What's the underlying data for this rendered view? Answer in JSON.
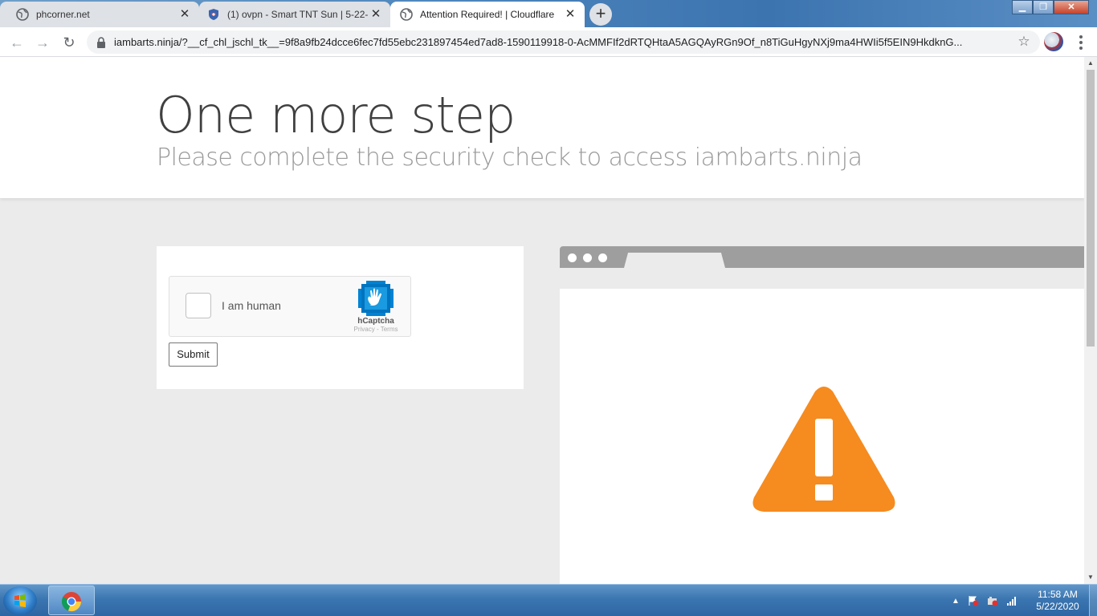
{
  "browser": {
    "tabs": [
      {
        "title": "phcorner.net",
        "favicon": "globe-icon"
      },
      {
        "title": "(1) ovpn - Smart TNT Sun | 5-22-",
        "favicon": "shield-icon"
      },
      {
        "title": "Attention Required! | Cloudflare",
        "favicon": "globe-icon",
        "active": true
      }
    ],
    "new_tab_label": "+",
    "url": "iambarts.ninja/?__cf_chl_jschl_tk__=9f8a9fb24dcce6fec7fd55ebc231897454ed7ad8-1590119918-0-AcMMFIf2dRTQHtaA5AGQAyRGn9Of_n8TiGuHgyNXj9ma4HWIi5f5EIN9HkdknG...",
    "close_glyph": "✕"
  },
  "page": {
    "heading": "One more step",
    "subheading": "Please complete the security check to access iambarts.ninja",
    "captcha": {
      "label": "I am human",
      "brand": "hCaptcha",
      "links": "Privacy - Terms"
    },
    "submit_label": "Submit",
    "warning_color": "#f68b1f"
  },
  "taskbar": {
    "time": "11:58 AM",
    "date": "5/22/2020"
  }
}
